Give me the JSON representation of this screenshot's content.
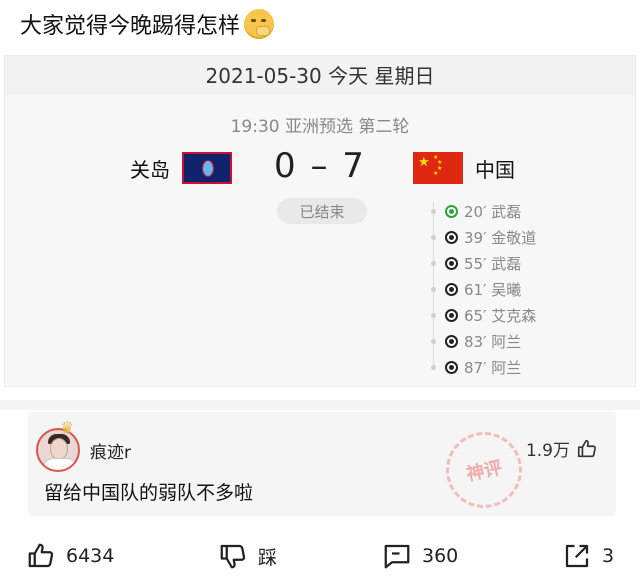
{
  "post": {
    "title": "大家觉得今晚踢得怎样"
  },
  "match": {
    "date_header": "2021-05-30 今天 星期日",
    "subtitle": "19:30 亚洲预选 第二轮",
    "home_team": "关岛",
    "away_team": "中国",
    "score": "0 – 7",
    "status": "已结束",
    "goals": [
      {
        "text": "20′ 武磊",
        "highlight": true
      },
      {
        "text": "39′ 金敬道",
        "highlight": false
      },
      {
        "text": "55′ 武磊",
        "highlight": false
      },
      {
        "text": "61′ 吴曦",
        "highlight": false
      },
      {
        "text": "65′ 艾克森",
        "highlight": false
      },
      {
        "text": "83′ 阿兰",
        "highlight": false
      },
      {
        "text": "87′ 阿兰",
        "highlight": false
      }
    ]
  },
  "comment": {
    "username": "痕迹r",
    "text": "留给中国队的弱队不多啦",
    "likes": "1.9万",
    "stamp_text": "神评"
  },
  "actions": {
    "like_count": "6434",
    "dislike_label": "踩",
    "comment_count": "360",
    "share_count": "3"
  },
  "colors": {
    "accent_green": "#2aa53a",
    "china_red": "#de2910",
    "guam_blue": "#10226b"
  }
}
